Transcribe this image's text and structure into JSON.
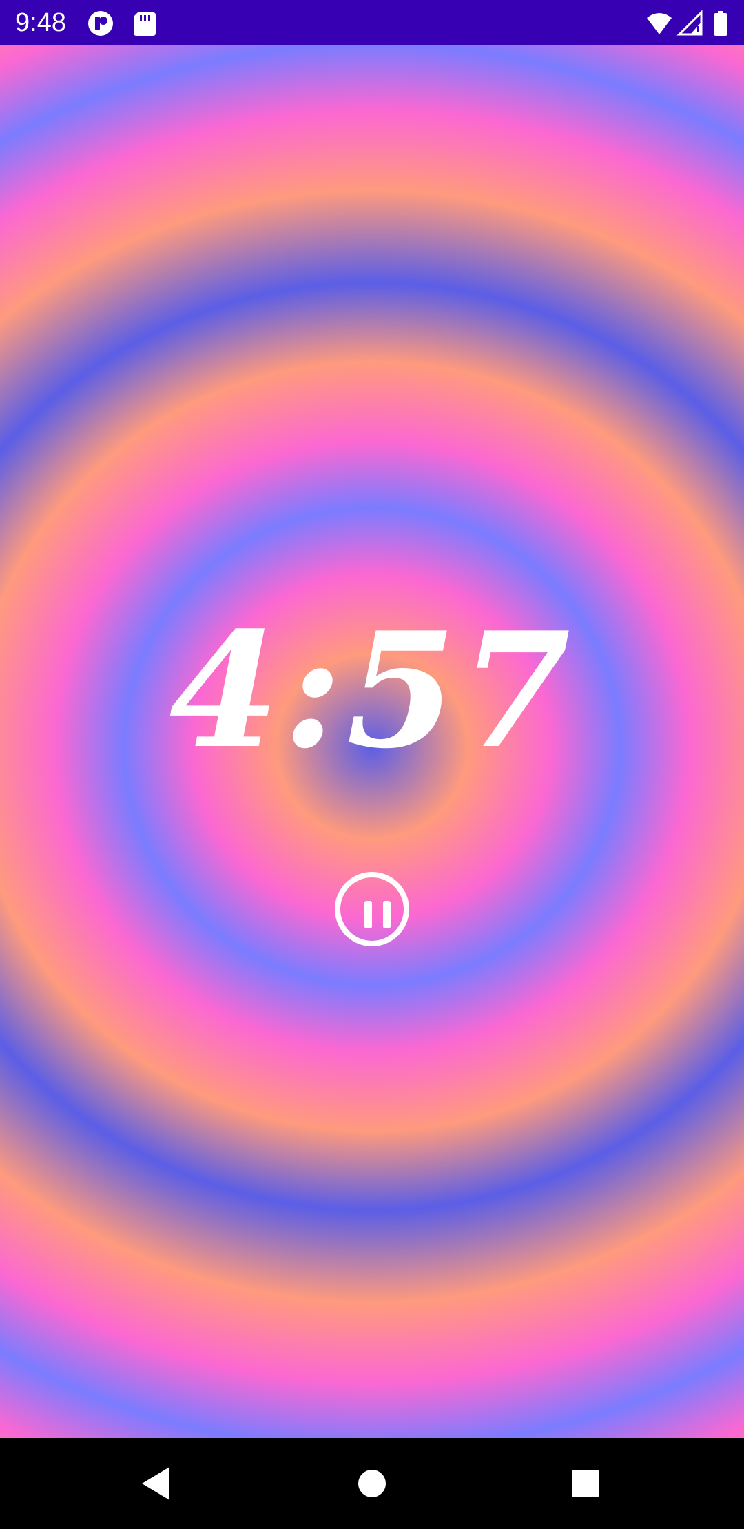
{
  "status_bar": {
    "time": "9:48",
    "background_color": "#3700b3",
    "icons": [
      "notification-app-icon",
      "sd-card-icon",
      "wifi-icon",
      "signal-icon",
      "battery-icon"
    ]
  },
  "timer": {
    "display": "4:57",
    "minutes": 4,
    "seconds": 57,
    "state": "running"
  },
  "controls": {
    "pause_icon": "pause-icon"
  },
  "background": {
    "colors": [
      "#5b5ee6",
      "#ff9a7d",
      "#fb68d2",
      "#7b7cff"
    ]
  },
  "nav_bar": {
    "buttons": [
      "back-icon",
      "home-icon",
      "recents-icon"
    ]
  }
}
